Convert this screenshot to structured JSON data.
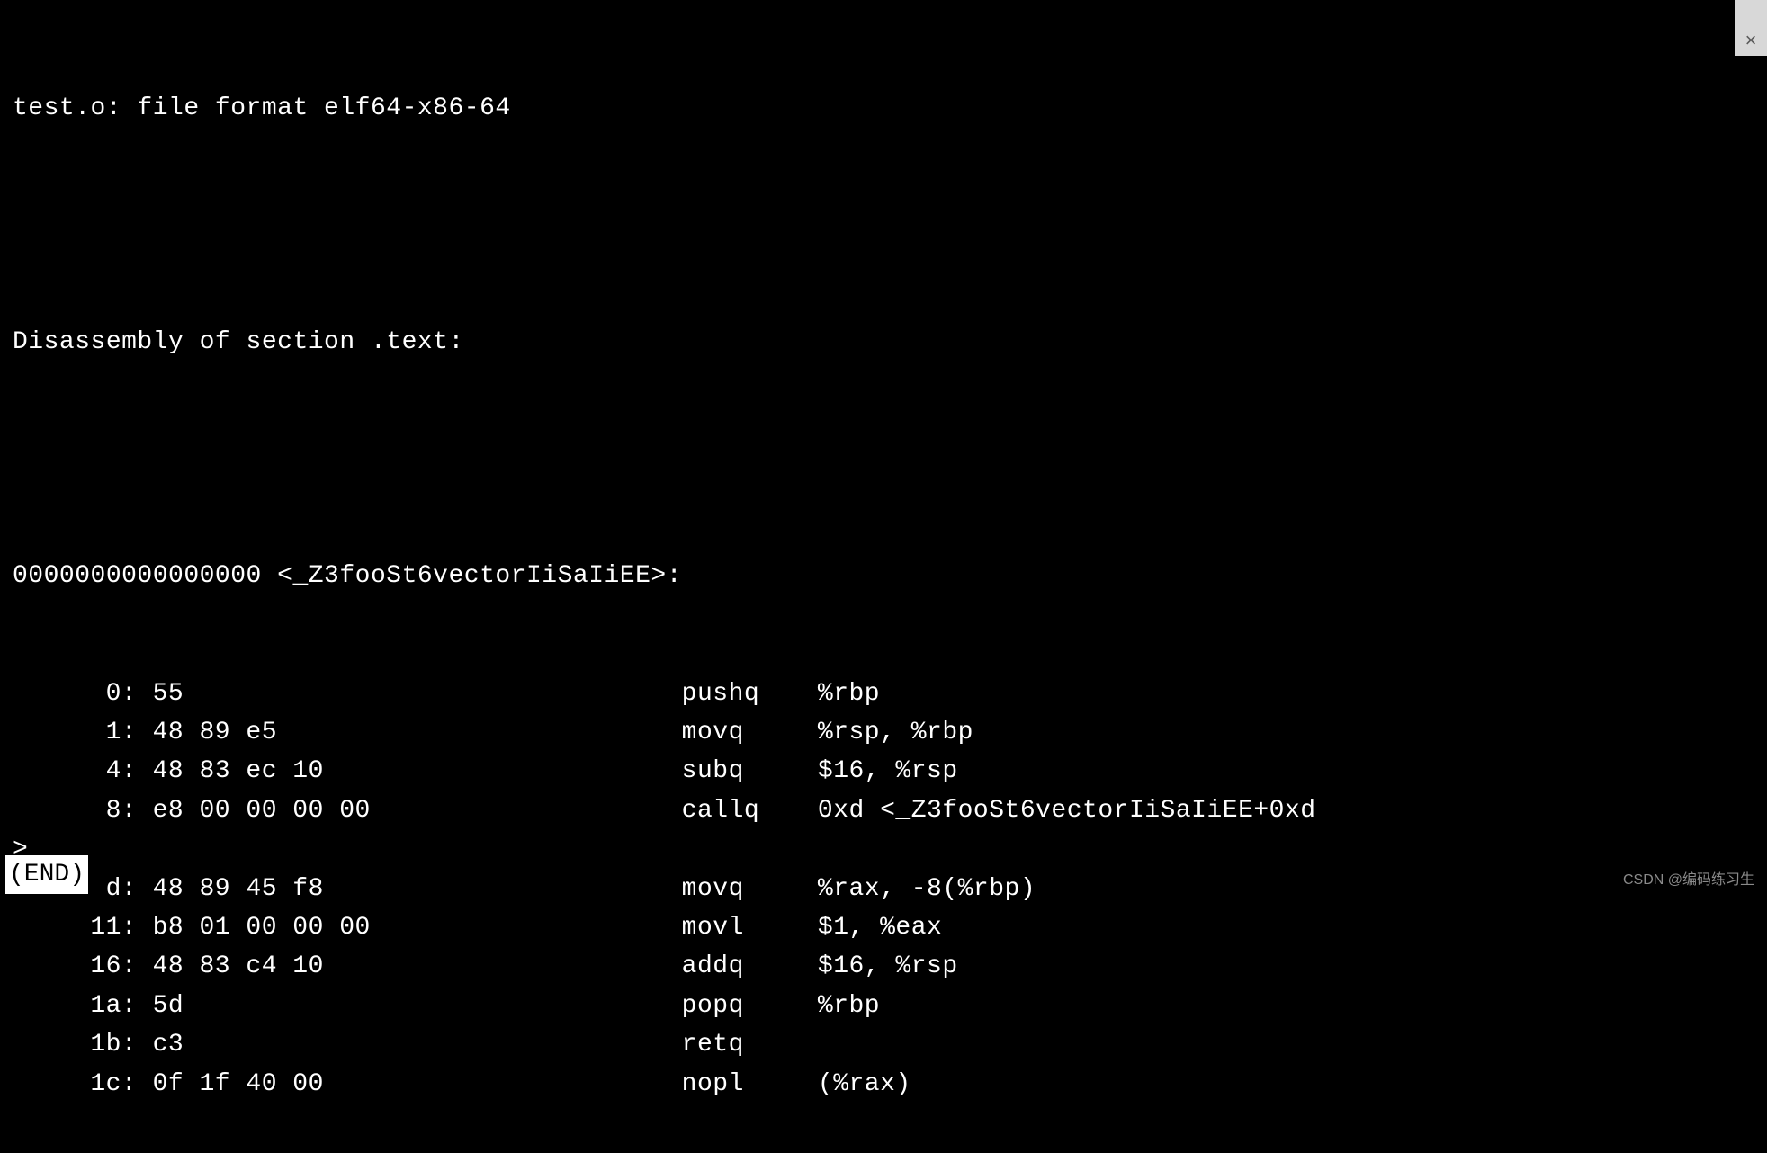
{
  "header": {
    "file_info": "test.o: file format elf64-x86-64",
    "section_header": "Disassembly of section .text:",
    "symbol_header": "0000000000000000 <_Z3fooSt6vectorIiSaIiEE>:"
  },
  "instructions": [
    {
      "offset": "0",
      "hex": "55",
      "mnemonic": "pushq",
      "operands": "%rbp"
    },
    {
      "offset": "1",
      "hex": "48 89 e5",
      "mnemonic": "movq",
      "operands": "%rsp, %rbp"
    },
    {
      "offset": "4",
      "hex": "48 83 ec 10",
      "mnemonic": "subq",
      "operands": "$16, %rsp"
    },
    {
      "offset": "8",
      "hex": "e8 00 00 00 00",
      "mnemonic": "callq",
      "operands": "0xd <_Z3fooSt6vectorIiSaIiEE+0xd"
    },
    {
      "offset": "d",
      "hex": "48 89 45 f8",
      "mnemonic": "movq",
      "operands": "%rax, -8(%rbp)"
    },
    {
      "offset": "11",
      "hex": "b8 01 00 00 00",
      "mnemonic": "movl",
      "operands": "$1, %eax"
    },
    {
      "offset": "16",
      "hex": "48 83 c4 10",
      "mnemonic": "addq",
      "operands": "$16, %rsp"
    },
    {
      "offset": "1a",
      "hex": "5d",
      "mnemonic": "popq",
      "operands": "%rbp"
    },
    {
      "offset": "1b",
      "hex": "c3",
      "mnemonic": "retq",
      "operands": ""
    },
    {
      "offset": "1c",
      "hex": "0f 1f 40 00",
      "mnemonic": "nopl",
      "operands": "(%rax)"
    }
  ],
  "wrap_continuation": ">",
  "wrap_after_index": 3,
  "end_marker": "(END)",
  "close_glyph": "×",
  "watermark": "CSDN @编码练习生"
}
